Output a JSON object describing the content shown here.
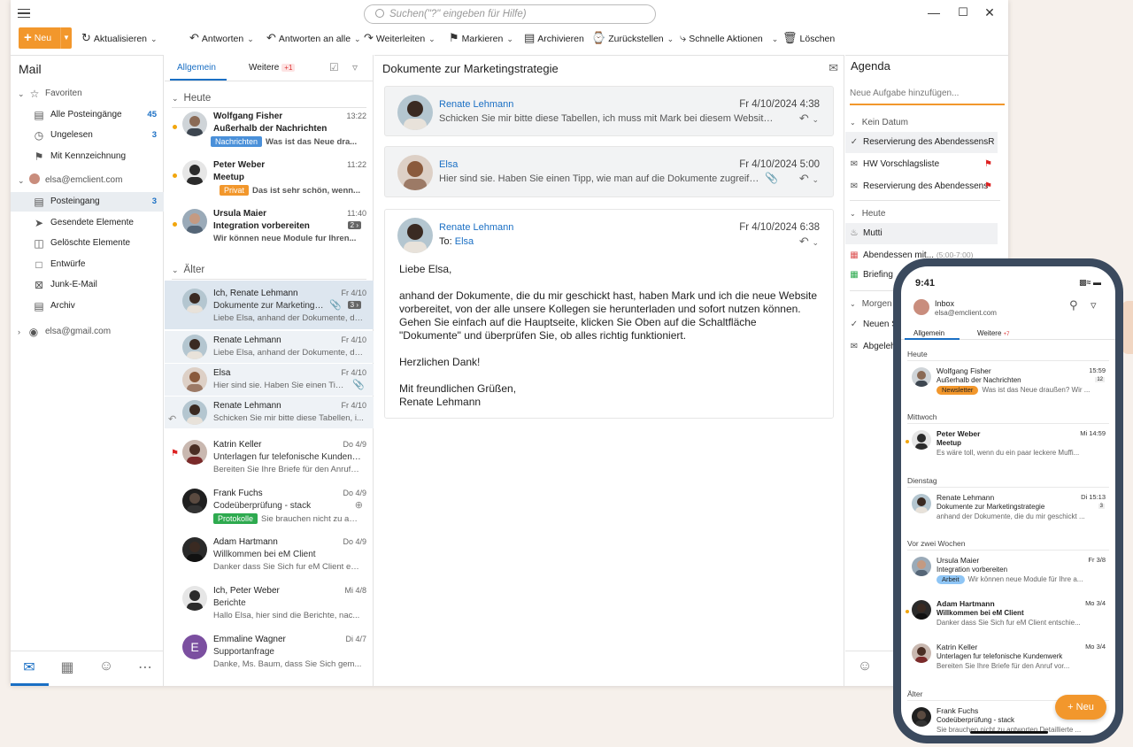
{
  "search": {
    "placeholder": "Suchen(\"?\" eingeben für Hilfe)"
  },
  "toolbar": {
    "new": "Neu",
    "refresh": "Aktualisieren",
    "reply": "Antworten",
    "reply_all": "Antworten an alle",
    "forward": "Weiterleiten",
    "mark": "Markieren",
    "archive": "Archivieren",
    "restore": "Zurückstellen",
    "quick": "Schnelle Aktionen",
    "delete": "Löschen"
  },
  "sidebar": {
    "title": "Mail",
    "favorites": "Favoriten",
    "all_inboxes": "Alle Posteingänge",
    "all_inboxes_count": "45",
    "unread": "Ungelesen",
    "unread_count": "3",
    "flagged": "Mit Kennzeichnung",
    "account1": "elsa@emclient.com",
    "inbox": "Posteingang",
    "inbox_count": "3",
    "sent": "Gesendete Elemente",
    "deleted": "Gelöschte Elemente",
    "drafts": "Entwürfe",
    "junk": "Junk-E-Mail",
    "archive": "Archiv",
    "account2": "elsa@gmail.com"
  },
  "list": {
    "tab1": "Allgemein",
    "tab2": "Weitere",
    "tab2_badge": "+1",
    "group_today": "Heute",
    "group_older": "Älter",
    "messages": [
      {
        "from": "Wolfgang Fisher",
        "date": "13:22",
        "subject": "Außerhalb der Nachrichten",
        "tag": "Nachrichten",
        "preview": "Was ist das Neue dra..."
      },
      {
        "from": "Peter Weber",
        "date": "11:22",
        "subject": "Meetup",
        "tag": "Privat",
        "preview": "Das ist sehr schön, wenn..."
      },
      {
        "from": "Ursula Maier",
        "date": "11:40",
        "subject": "Integration vorbereiten",
        "count": "2",
        "preview": "Wir können neue Module fur Ihren..."
      },
      {
        "from": "Ich, Renate Lehmann",
        "date": "Fr 4/10",
        "subject": "Dokumente zur Marketingst...",
        "count": "3",
        "preview": "Liebe Elsa, anhand der Dokumente, die ..."
      },
      {
        "from": "Renate Lehmann",
        "date": "Fr 4/10",
        "subject": "Liebe Elsa, anhand der Dokumente, die ..."
      },
      {
        "from": "Elsa",
        "date": "Fr 4/10",
        "subject": "Hier sind sie. Haben Sie einen Tipp..."
      },
      {
        "from": "Renate Lehmann",
        "date": "Fr 4/10",
        "subject": "Schicken Sie mir bitte diese Tabellen, i..."
      },
      {
        "from": "Katrin Keller",
        "date": "Do 4/9",
        "subject": "Unterlagen fur telefonische Kundenwe...",
        "preview": "Bereiten Sie Ihre Briefe für den Anrufe ..."
      },
      {
        "from": "Frank Fuchs",
        "date": "Do 4/9",
        "subject": "Codeüberprüfung - stack",
        "tag": "Protokolle",
        "preview": "Sie brauchen nicht zu an..."
      },
      {
        "from": "Adam Hartmann",
        "date": "Do 4/9",
        "subject": "Willkommen bei eM Client",
        "preview": "Danker dass Sie Sich fur eM Client ents..."
      },
      {
        "from": "Ich, Peter Weber",
        "date": "Mi 4/8",
        "subject": "Berichte",
        "preview": "Hallo Elsa, hier sind die Berichte, nac..."
      },
      {
        "from": "Emmaline Wagner",
        "date": "Di 4/7",
        "subject": "Supportanfrage",
        "preview": "Danke, Ms. Baum, dass Sie Sich gem...",
        "initial": "E"
      }
    ]
  },
  "reading": {
    "title": "Dokumente zur Marketingstrategie",
    "cards": [
      {
        "from": "Renate Lehmann",
        "date": "Fr 4/10/2024 4:38",
        "snippet": "Schicken Sie mir bitte diese Tabellen, ich muss mit Mark bei diesem Website-Projekt..."
      },
      {
        "from": "Elsa",
        "date": "Fr 4/10/2024 5:00",
        "snippet": "Hier sind sie. Haben Sie einen Tipp, wie man auf die Dokumente zugreifen kann..."
      }
    ],
    "open": {
      "from": "Renate Lehmann",
      "date": "Fr 4/10/2024 6:38",
      "to_label": "To:",
      "to": "Elsa",
      "p1": "Liebe Elsa,",
      "p2": "anhand der Dokumente, die du mir geschickt hast, haben Mark und ich die neue Website\nvorbereitet, von der alle unsere Kollegen sie herunterladen und sofort nutzen können.\nGehen Sie einfach auf die Hauptseite, klicken Sie Oben auf die Schaltfläche\n\"Dokumente\" und überprüfen Sie, ob alles richtig funktioniert.",
      "p3": "Herzlichen Dank!",
      "p4": "Mit freundlichen Grüßen,\nRenate Lehmann"
    }
  },
  "agenda": {
    "title": "Agenda",
    "new_task": "Neue Aufgabe hinzufügen...",
    "g_nodate": "Kein Datum",
    "t1": "Reservierung des AbendessensR",
    "t2": "HW Vorschlagsliste",
    "t3": "Reservierung des Abendessens",
    "g_today": "Heute",
    "e1": "Mutti",
    "e2": "Abendessen mit...",
    "e2_time": "(5:00-7:00)",
    "e3": "Briefing",
    "g_tomorrow": "Morgen",
    "e4": "Neuen S",
    "e5": "Abgeleh"
  },
  "phone": {
    "time": "9:41",
    "inbox": "Inbox",
    "account": "elsa@emclient.com",
    "tab1": "Allgemein",
    "tab2": "Weitere",
    "tab2_badge": "+7",
    "g_heute": "Heute",
    "g_mittwoch": "Mittwoch",
    "g_dienstag": "Dienstag",
    "g_vorzwei": "Vor zwei Wochen",
    "g_aelter": "Älter",
    "m1": {
      "from": "Wolfgang Fisher",
      "date": "15:59",
      "subject": "Außerhalb der Nachrichten",
      "tag": "Newsletter",
      "preview": "Was ist das Neue draußen? Wir ...",
      "count": "12"
    },
    "m2": {
      "from": "Peter Weber",
      "date": "Mi 14:59",
      "subject": "Meetup",
      "preview": "Es wäre toll, wenn du ein paar leckere Muffi..."
    },
    "m3": {
      "from": "Renate Lehmann",
      "date": "Di 15:13",
      "subject": "Dokumente zur Marketingstrategie",
      "preview": "anhand der Dokumente, die du mir geschickt ...",
      "count": "3"
    },
    "m4": {
      "from": "Ursula Maier",
      "date": "Fr 3/8",
      "subject": "Integration vorbereiten",
      "tag": "Arbeit",
      "preview": "Wir können neue Module für Ihre a..."
    },
    "m5": {
      "from": "Adam Hartmann",
      "date": "Mo 3/4",
      "subject": "Willkommen bei eM Client",
      "preview": "Danker dass Sie Sich fur eM Client entschie..."
    },
    "m6": {
      "from": "Katrin Keller",
      "date": "Mo 3/4",
      "subject": "Unterlagen fur telefonische Kundenwerk",
      "preview": "Bereiten Sie Ihre Briefe für den Anruf vor..."
    },
    "m7": {
      "from": "Frank Fuchs",
      "subject": "Codeüberprüfung - stack",
      "preview": "Sie brauchen nicht zu antworten Detaillierte ..."
    },
    "new": "Neu"
  },
  "colors": {
    "accent": "#1a6fc4",
    "new_button": "#f2972c",
    "tag_blue": "#4a90d9",
    "tag_orange": "#f2972c",
    "tag_green": "#2eaa4f",
    "flag": "#d22222"
  }
}
